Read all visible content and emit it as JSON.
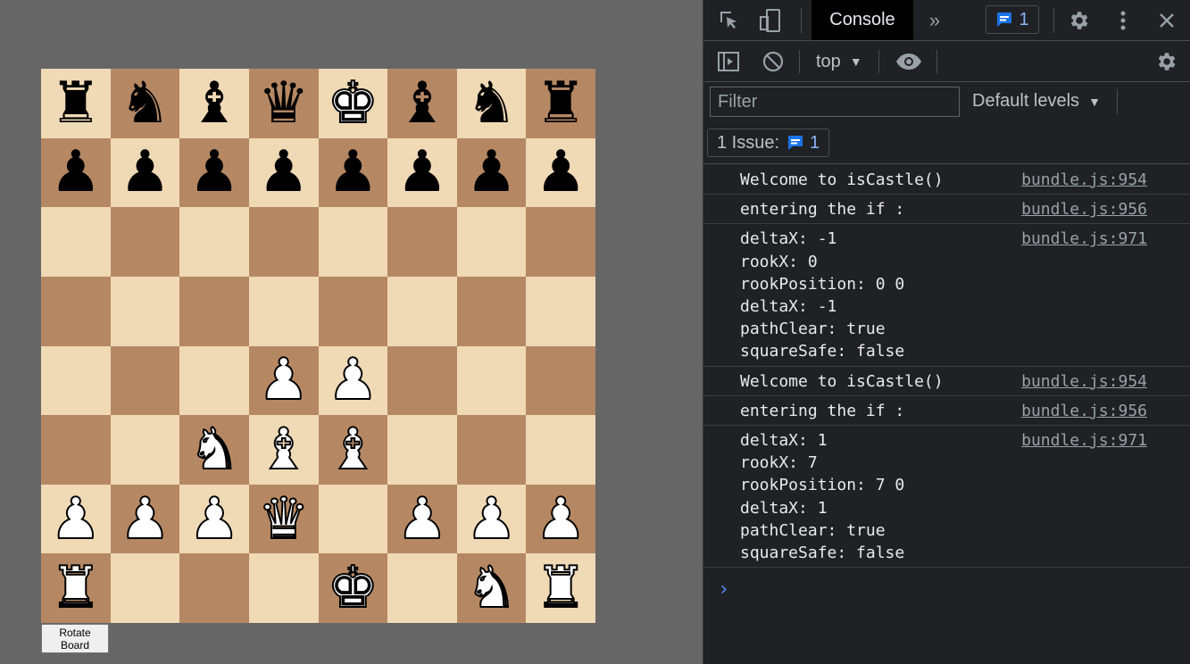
{
  "board": {
    "rows": [
      [
        {
          "piece": "♜",
          "side": "black",
          "name": "black-rook"
        },
        {
          "piece": "♞",
          "side": "black",
          "name": "black-knight"
        },
        {
          "piece": "♝",
          "side": "black",
          "name": "black-bishop"
        },
        {
          "piece": "♛",
          "side": "black",
          "name": "black-queen"
        },
        {
          "piece": "♚",
          "side": "white",
          "name": "black-king"
        },
        {
          "piece": "♝",
          "side": "black",
          "name": "black-bishop"
        },
        {
          "piece": "♞",
          "side": "black",
          "name": "black-knight"
        },
        {
          "piece": "♜",
          "side": "black",
          "name": "black-rook"
        }
      ],
      [
        {
          "piece": "♟",
          "side": "black",
          "name": "black-pawn"
        },
        {
          "piece": "♟",
          "side": "black",
          "name": "black-pawn"
        },
        {
          "piece": "♟",
          "side": "black",
          "name": "black-pawn"
        },
        {
          "piece": "♟",
          "side": "black",
          "name": "black-pawn"
        },
        {
          "piece": "♟",
          "side": "black",
          "name": "black-pawn"
        },
        {
          "piece": "♟",
          "side": "black",
          "name": "black-pawn"
        },
        {
          "piece": "♟",
          "side": "black",
          "name": "black-pawn"
        },
        {
          "piece": "♟",
          "side": "black",
          "name": "black-pawn"
        }
      ],
      [
        null,
        null,
        null,
        null,
        null,
        null,
        null,
        null
      ],
      [
        null,
        null,
        null,
        null,
        null,
        null,
        null,
        null
      ],
      [
        null,
        null,
        null,
        {
          "piece": "♟",
          "side": "white",
          "name": "white-pawn"
        },
        {
          "piece": "♟",
          "side": "white",
          "name": "white-pawn"
        },
        null,
        null,
        null
      ],
      [
        null,
        null,
        {
          "piece": "♞",
          "side": "white",
          "name": "white-knight"
        },
        {
          "piece": "♝",
          "side": "white",
          "name": "white-bishop"
        },
        {
          "piece": "♝",
          "side": "white",
          "name": "white-bishop"
        },
        null,
        null,
        null
      ],
      [
        {
          "piece": "♟",
          "side": "white",
          "name": "white-pawn"
        },
        {
          "piece": "♟",
          "side": "white",
          "name": "white-pawn"
        },
        {
          "piece": "♟",
          "side": "white",
          "name": "white-pawn"
        },
        {
          "piece": "♛",
          "side": "white",
          "name": "white-queen"
        },
        null,
        {
          "piece": "♟",
          "side": "white",
          "name": "white-pawn"
        },
        {
          "piece": "♟",
          "side": "white",
          "name": "white-pawn"
        },
        {
          "piece": "♟",
          "side": "white",
          "name": "white-pawn"
        }
      ],
      [
        {
          "piece": "♜",
          "side": "white",
          "name": "white-rook"
        },
        null,
        null,
        null,
        {
          "piece": "♚",
          "side": "white",
          "name": "white-king"
        },
        null,
        {
          "piece": "♞",
          "side": "white",
          "name": "white-knight"
        },
        {
          "piece": "♜",
          "side": "white",
          "name": "white-rook"
        }
      ]
    ],
    "colors": {
      "light": "#f0d9b5",
      "dark": "#b58863"
    }
  },
  "rotate_button": {
    "line1": "Rotate",
    "line2": "Board"
  },
  "devtools": {
    "tabs": {
      "console": "Console"
    },
    "issues_badge_count": "1",
    "toolbar": {
      "context": "top"
    },
    "filter": {
      "placeholder": "Filter",
      "levels": "Default levels"
    },
    "issues_bar": {
      "label": "1 Issue:",
      "count": "1"
    },
    "log": [
      {
        "lines": [
          "Welcome to isCastle()"
        ],
        "source": "bundle.js:954"
      },
      {
        "lines": [
          "entering the if :"
        ],
        "source": "bundle.js:956"
      },
      {
        "lines": [
          "deltaX: -1",
          "rookX: 0",
          "rookPosition: 0 0",
          "deltaX: -1",
          "pathClear: true",
          "squareSafe: false"
        ],
        "source": "bundle.js:971"
      },
      {
        "lines": [
          "Welcome to isCastle()"
        ],
        "source": "bundle.js:954"
      },
      {
        "lines": [
          "entering the if :"
        ],
        "source": "bundle.js:956"
      },
      {
        "lines": [
          "deltaX: 1",
          "rookX: 7",
          "rookPosition: 7 0",
          "deltaX: 1",
          "pathClear: true",
          "squareSafe: false"
        ],
        "source": "bundle.js:971"
      }
    ],
    "prompt": "›",
    "icons": [
      "inspect-element-icon",
      "device-toolbar-icon",
      "more-tabs-icon",
      "issues-icon",
      "settings-icon",
      "kebab-menu-icon",
      "close-icon",
      "sidebar-toggle-icon",
      "clear-console-icon",
      "live-expression-eye-icon",
      "console-settings-icon"
    ]
  }
}
